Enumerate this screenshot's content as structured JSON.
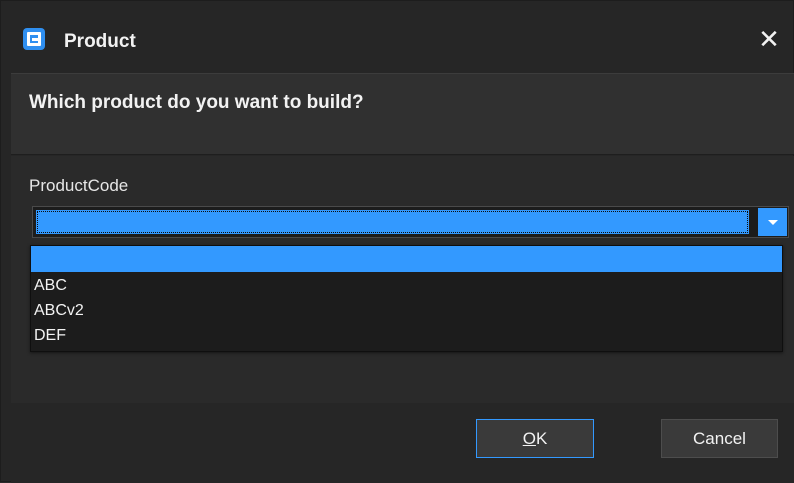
{
  "window": {
    "title": "Product",
    "icon": "app-logo-icon",
    "close_icon": "close-icon",
    "close_glyph": "✕"
  },
  "header": {
    "question": "Which product do you want to build?"
  },
  "form": {
    "field_label": "ProductCode",
    "combo": {
      "selected_value": "",
      "arrow_icon": "chevron-down-icon",
      "options": [
        "",
        "ABC",
        "ABCv2",
        "DEF"
      ]
    }
  },
  "footer": {
    "ok_mnemonic": "O",
    "ok_rest": "K",
    "cancel_label": "Cancel"
  },
  "colors": {
    "accent": "#3399ff",
    "window_bg": "#262626",
    "panel_bg": "#303030",
    "text": "#f2f2f2"
  }
}
